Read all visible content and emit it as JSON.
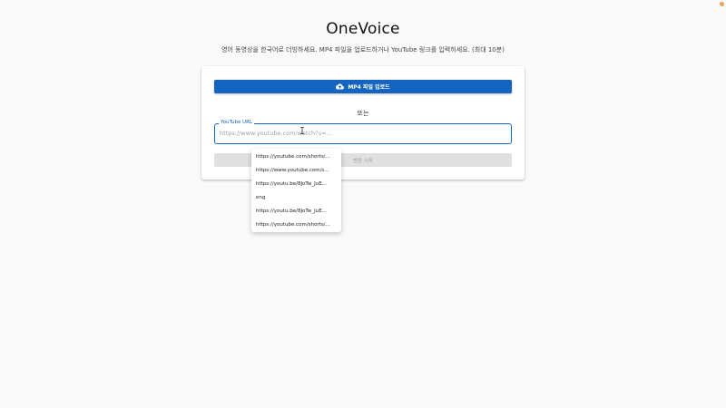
{
  "app": {
    "title": "OneVoice",
    "subtitle": "영어 동영상을 한국어로 더빙하세요. MP4 파일을 업로드하거나 YouTube 링크를 입력하세요. (최대 10분)"
  },
  "card": {
    "upload_button_label": "MP4 파일 업로드",
    "upload_icon": "cloud-upload-icon",
    "or_text": "또는",
    "url_field": {
      "label": "YouTube URL",
      "placeholder": "https://www.youtube.com/watch?v=...",
      "value": ""
    },
    "start_button_label": "변환 시작"
  },
  "autocomplete": {
    "items": [
      "https://youtube.com/shorts/...",
      "https://www.youtube.com/s...",
      "https://youtu.be/8JoTw_JuE...",
      "eng",
      "https://youtu.be/8JoTw_JuE...",
      "https://youtube.com/shorts/..."
    ]
  },
  "colors": {
    "primary": "#1565c0",
    "background": "#fafafa",
    "disabled": "#e0e0e0"
  }
}
